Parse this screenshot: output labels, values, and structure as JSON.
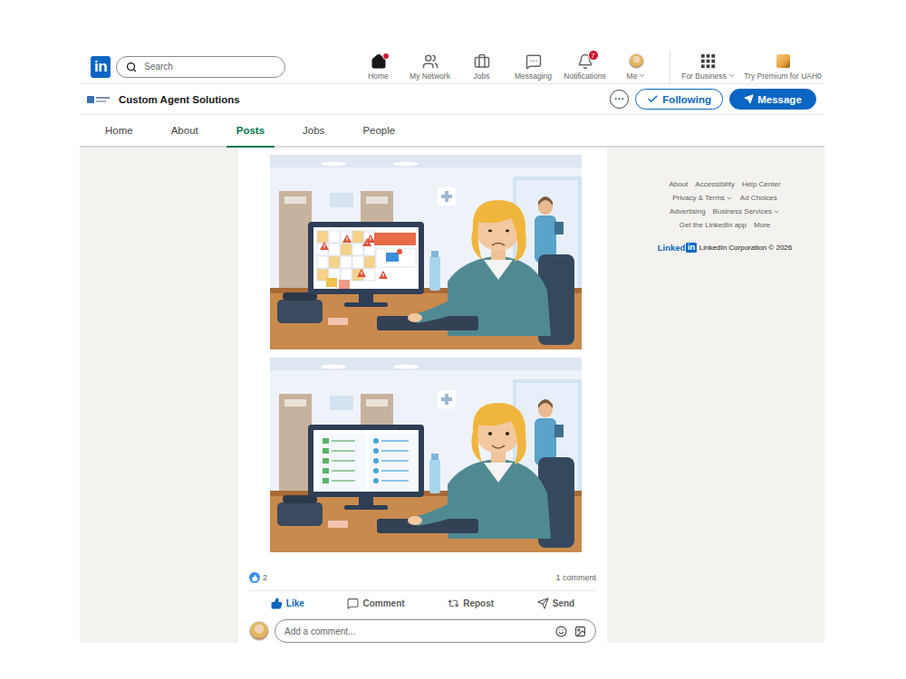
{
  "topbar": {
    "logo": "in",
    "search": {
      "placeholder": "Search"
    },
    "nav": [
      {
        "label": "Home",
        "kind": "home",
        "dot": true,
        "badge": "",
        "has_menu": false
      },
      {
        "label": "My Network",
        "kind": "network",
        "dot": false,
        "badge": "",
        "has_menu": false
      },
      {
        "label": "Jobs",
        "kind": "jobs",
        "dot": false,
        "badge": "",
        "has_menu": false
      },
      {
        "label": "Messaging",
        "kind": "messaging",
        "dot": false,
        "badge": "",
        "has_menu": false
      },
      {
        "label": "Notifications",
        "kind": "notifications",
        "dot": false,
        "badge": "7",
        "has_menu": false
      },
      {
        "label": "Me",
        "kind": "avatar",
        "dot": false,
        "badge": "",
        "has_menu": true
      }
    ],
    "business": {
      "label": "For Business",
      "has_menu": true
    },
    "premium": {
      "label": "Try Premium for UAH0"
    }
  },
  "company": {
    "name": "Custom Agent Solutions",
    "more": "···",
    "following": {
      "label": "Following",
      "selected": true
    },
    "message": "Message"
  },
  "tabs": [
    {
      "label": "Home",
      "selected": false
    },
    {
      "label": "About",
      "selected": false
    },
    {
      "label": "Posts",
      "selected": true
    },
    {
      "label": "Jobs",
      "selected": false
    },
    {
      "label": "People",
      "selected": false
    }
  ],
  "post": {
    "images": [
      {
        "kind": "alerts"
      },
      {
        "kind": "calm"
      }
    ],
    "reactions": "2",
    "comments": "1 comment",
    "actions": [
      {
        "label": "Like",
        "kind": "like",
        "selected": true
      },
      {
        "label": "Comment",
        "kind": "comment",
        "selected": false
      },
      {
        "label": "Repost",
        "kind": "repost",
        "selected": false
      },
      {
        "label": "Send",
        "kind": "send",
        "selected": false
      }
    ],
    "comment_placeholder": "Add a comment..."
  },
  "footer": {
    "rows": [
      [
        {
          "label": "About",
          "has_menu": false
        },
        {
          "label": "Accessibility",
          "has_menu": false
        },
        {
          "label": "Help Center",
          "has_menu": false
        }
      ],
      [
        {
          "label": "Privacy & Terms",
          "has_menu": true
        },
        {
          "label": "Ad Choices",
          "has_menu": false
        }
      ],
      [
        {
          "label": "Advertising",
          "has_menu": false
        },
        {
          "label": "Business Services",
          "has_menu": true
        }
      ],
      [
        {
          "label": "Get the LinkedIn app",
          "has_menu": false
        },
        {
          "label": "More",
          "has_menu": false
        }
      ]
    ],
    "copyright": {
      "logo": [
        "Linked",
        "in"
      ],
      "text": "LinkedIn Corporation © 2026"
    }
  }
}
